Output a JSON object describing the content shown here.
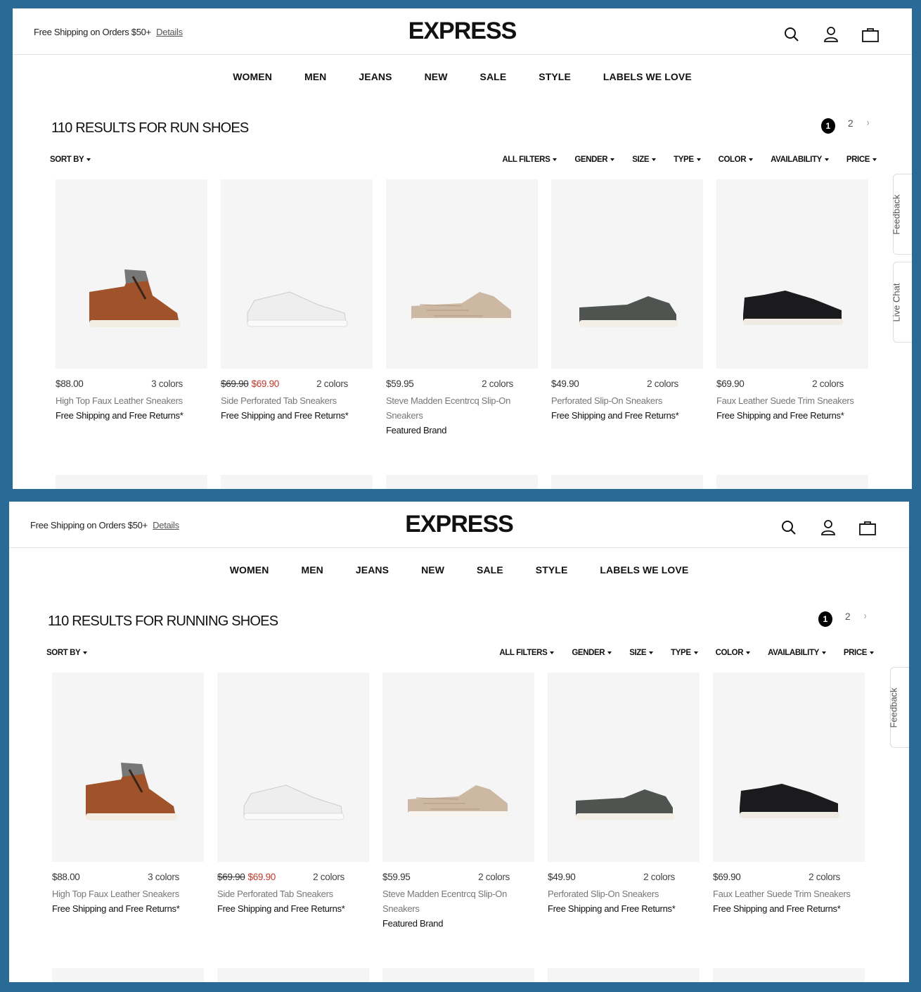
{
  "colors": {
    "frame": "#2a6a96",
    "sale": "#c0392b",
    "tile": "#f5f5f5"
  },
  "header": {
    "promo_text": "Free Shipping on Orders $50+",
    "promo_link": "Details",
    "logo": "EXPRESS",
    "icons": [
      "search-icon",
      "account-icon",
      "bag-icon"
    ]
  },
  "nav": [
    "WOMEN",
    "MEN",
    "JEANS",
    "NEW",
    "SALE",
    "STYLE",
    "LABELS WE LOVE"
  ],
  "pagination": {
    "current": "1",
    "next_page": "2",
    "next_icon": "›"
  },
  "sort_label": "SORT BY",
  "filters": [
    "ALL FILTERS",
    "GENDER",
    "SIZE",
    "TYPE",
    "COLOR",
    "AVAILABILITY",
    "PRICE"
  ],
  "panels": [
    {
      "results_title": "110 RESULTS FOR RUN SHOES",
      "side_tabs": [
        "Feedback",
        "Live Chat"
      ]
    },
    {
      "results_title": "110 RESULTS FOR RUNNING SHOES",
      "side_tabs": [
        "Feedback"
      ]
    }
  ],
  "products": [
    {
      "price": "$88.00",
      "old_price": "",
      "colors": "3 colors",
      "name": "High Top Faux Leather Sneakers",
      "note": "Free Shipping and Free Returns*",
      "shoe": "brown-high-top"
    },
    {
      "price": "$69.90",
      "old_price": "$69.90",
      "colors": "2 colors",
      "name": "Side Perforated Tab Sneakers",
      "note": "Free Shipping and Free Returns*",
      "shoe": "white-sneaker"
    },
    {
      "price": "$59.95",
      "old_price": "",
      "colors": "2 colors",
      "name": "Steve Madden Ecentrcq Slip-On Sneakers",
      "note": "Featured Brand",
      "shoe": "beige-slip-on"
    },
    {
      "price": "$49.90",
      "old_price": "",
      "colors": "2 colors",
      "name": "Perforated Slip-On Sneakers",
      "note": "Free Shipping and Free Returns*",
      "shoe": "grey-slip-on"
    },
    {
      "price": "$69.90",
      "old_price": "",
      "colors": "2 colors",
      "name": "Faux Leather Suede Trim Sneakers",
      "note": "Free Shipping and Free Returns*",
      "shoe": "black-sneaker"
    }
  ]
}
